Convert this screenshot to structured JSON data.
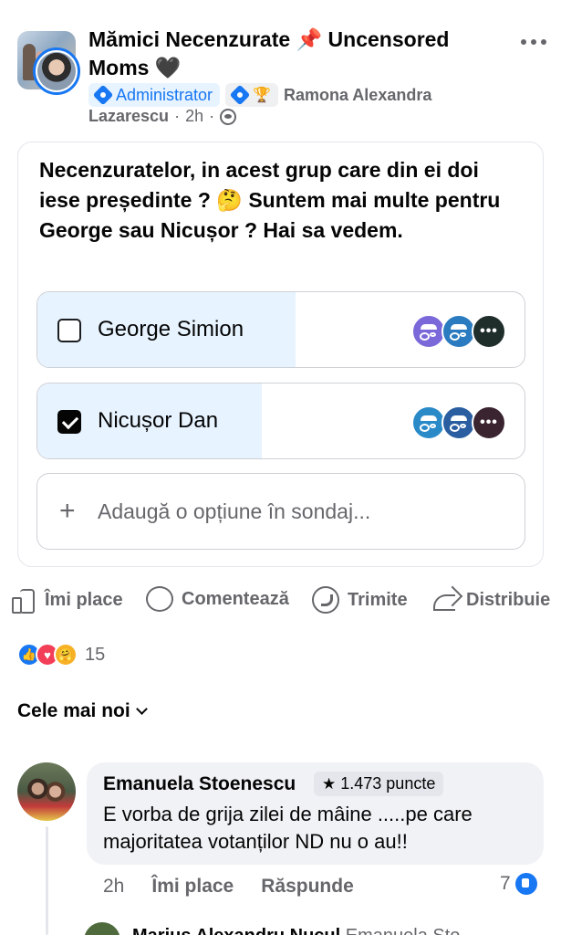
{
  "post": {
    "group_title": "Mămici Necenzurate 📌 Uncensored Moms 🖤",
    "admin_badge": "Administrator",
    "author_first": "Ramona Alexandra",
    "author_last": "Lazarescu",
    "time": "2h",
    "privacy_icon": "group-icon",
    "more_icon": "more-icon"
  },
  "poll": {
    "question": "Necenzuratelor, in acest grup care din ei doi iese președinte ? 🤔 Suntem mai multe pentru George sau Nicușor ? Hai sa vedem.",
    "options": [
      {
        "label": "George Simion",
        "checked": false,
        "vote_share": 0.53
      },
      {
        "label": "Nicușor Dan",
        "checked": true,
        "vote_share": 0.46
      }
    ],
    "add_option": "Adaugă o opțiune în sondaj..."
  },
  "actions": {
    "like": "Îmi place",
    "comment": "Comentează",
    "send": "Trimite",
    "share": "Distribuie"
  },
  "reactions": {
    "count": "15",
    "types": [
      "like",
      "love",
      "care"
    ]
  },
  "comments_sort": "Cele mai noi",
  "comment": {
    "author": "Emanuela Stoenescu",
    "points": "1.473 puncte",
    "text": "E vorba de grija zilei de mâine .....pe care majoritatea votanților ND nu o au!!",
    "time": "2h",
    "like": "Îmi place",
    "reply": "Răspunde",
    "likes": "7"
  },
  "next_reply": {
    "author": "Marius Alexandru Nucul",
    "preview": "Emanuela Sto"
  },
  "colors": {
    "accent": "#1877f2",
    "option_fill": "#e7f3ff",
    "muted_text": "#65676b"
  }
}
